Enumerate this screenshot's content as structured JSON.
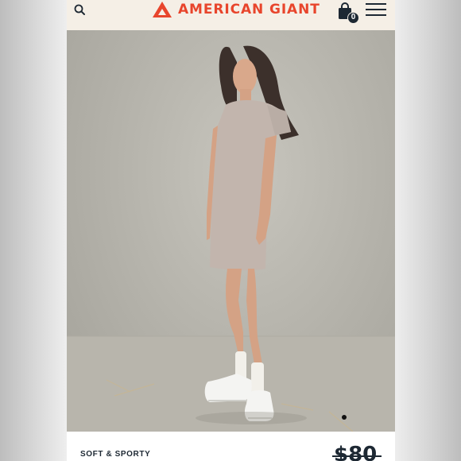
{
  "header": {
    "brand": "AMERICAN GIANT",
    "cart_count": "0",
    "logo_icon": "triangle-a-logo-icon",
    "search_icon": "search-icon",
    "cart_icon": "shopping-bag-icon",
    "menu_icon": "hamburger-menu-icon"
  },
  "product": {
    "tagline": "SOFT & SPORTY",
    "price": "$80"
  },
  "carousel": {
    "dot_count": 1,
    "active_index": 0
  },
  "colors": {
    "brand": "#e8452c",
    "header_bg": "#f5efe6",
    "ink": "#1d2833"
  }
}
